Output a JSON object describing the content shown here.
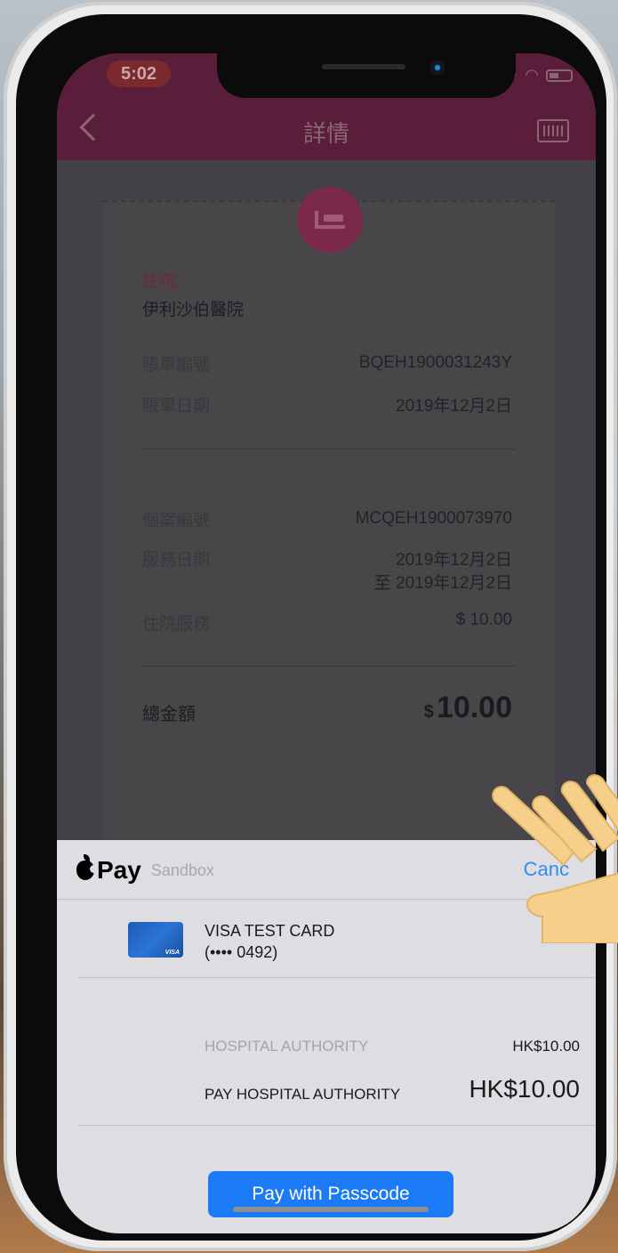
{
  "status": {
    "time": "5:02"
  },
  "header": {
    "title": "詳情"
  },
  "record": {
    "category": "住院",
    "hospital": "伊利沙伯醫院",
    "bill_no_label": "賬單編號",
    "bill_no": "BQEH1900031243Y",
    "bill_date_label": "賬單日期",
    "bill_date": "2019年12月2日",
    "case_no_label": "個案編號",
    "case_no": "MCQEH1900073970",
    "service_date_label": "服務日期",
    "service_date_from": "2019年12月2日",
    "service_date_to": "至 2019年12月2日",
    "service_label": "住院服務",
    "service_amount": "$ 10.00",
    "total_label": "總金額",
    "total_currency": "$",
    "total_amount": "10.00"
  },
  "applepay": {
    "brand": "Pay",
    "sandbox": "Sandbox",
    "cancel": "Canc",
    "card_name": "VISA TEST CARD",
    "card_number": "(•••• 0492)",
    "card_logo": "VISA",
    "merchant_label": "HOSPITAL AUTHORITY",
    "merchant_amount": "HK$10.00",
    "pay_label": "PAY HOSPITAL AUTHORITY",
    "pay_amount": "HK$10.00",
    "pay_button": "Pay with Passcode"
  }
}
